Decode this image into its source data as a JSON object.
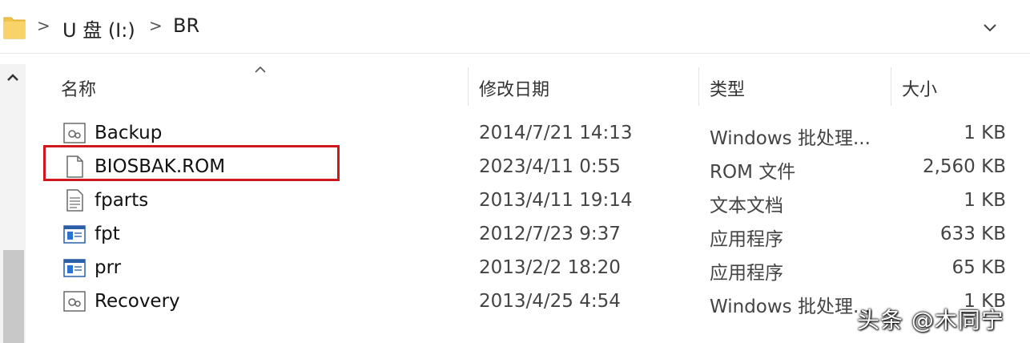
{
  "breadcrumb": {
    "items": [
      "U 盘 (I:)",
      "BR"
    ],
    "separator": ">"
  },
  "columns": {
    "name": "名称",
    "date": "修改日期",
    "type": "类型",
    "size": "大小"
  },
  "files": [
    {
      "name": "Backup",
      "date": "2014/7/21 14:13",
      "type": "Windows 批处理...",
      "size": "1 KB",
      "icon": "batch-file-icon"
    },
    {
      "name": "BIOSBAK.ROM",
      "date": "2023/4/11 0:55",
      "type": "ROM 文件",
      "size": "2,560 KB",
      "icon": "blank-file-icon"
    },
    {
      "name": "fparts",
      "date": "2013/4/11 19:14",
      "type": "文本文档",
      "size": "1 KB",
      "icon": "text-file-icon"
    },
    {
      "name": "fpt",
      "date": "2012/7/23 9:37",
      "type": "应用程序",
      "size": "633 KB",
      "icon": "application-icon"
    },
    {
      "name": "prr",
      "date": "2013/2/2 18:20",
      "type": "应用程序",
      "size": "65 KB",
      "icon": "application-icon"
    },
    {
      "name": "Recovery",
      "date": "2013/4/25 4:54",
      "type": "Windows 批处理...",
      "size": "1 KB",
      "icon": "batch-file-icon"
    }
  ],
  "watermark": "头条 @木同宁",
  "colors": {
    "highlight": "#d0191f",
    "folder": "#f3c44a"
  }
}
